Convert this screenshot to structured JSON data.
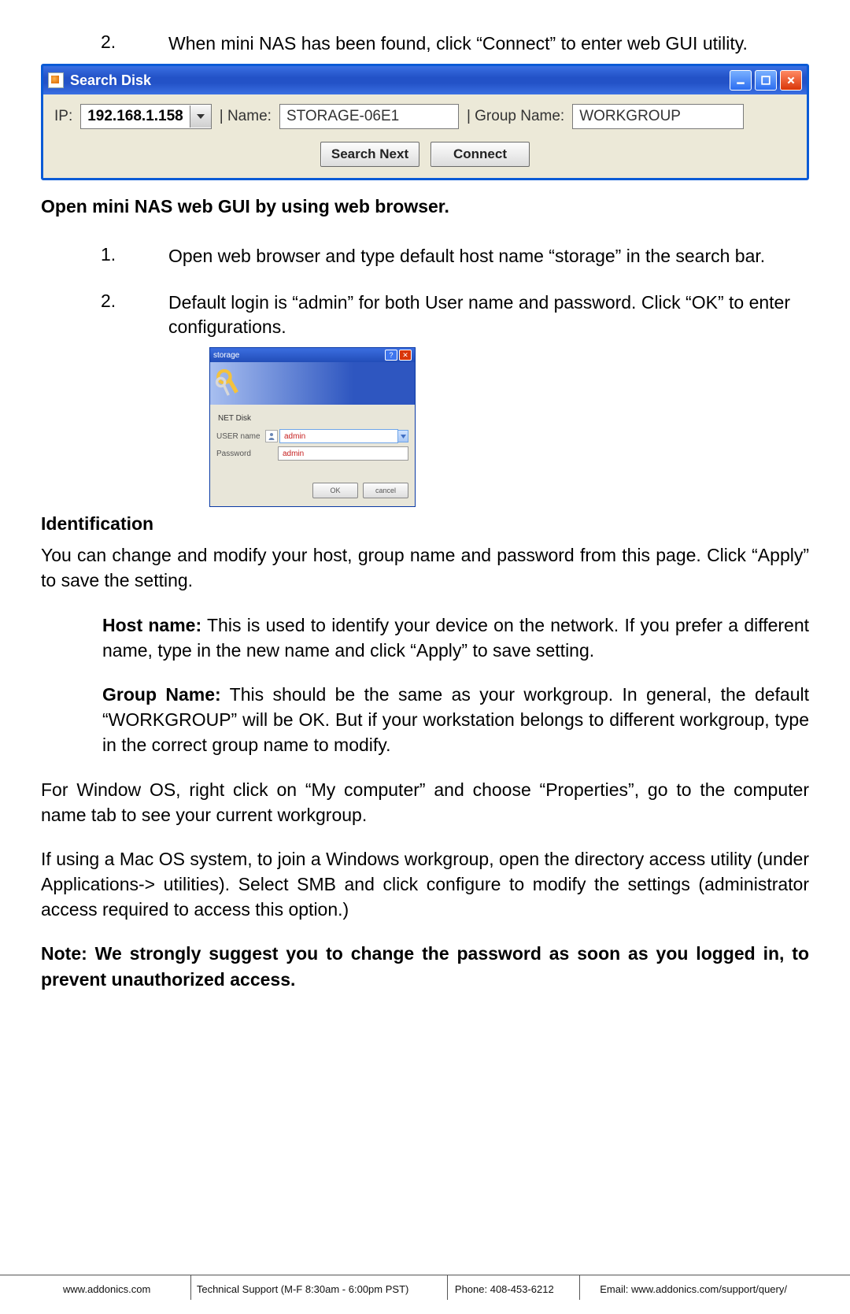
{
  "step2": {
    "num": "2.",
    "text": "When mini NAS has been found, click “Connect” to enter web GUI utility."
  },
  "searchwin": {
    "title": "Search Disk",
    "ip_label": "IP:",
    "ip_value": "192.168.1.158",
    "name_label": "| Name:",
    "name_value": "STORAGE-06E1",
    "group_label": "| Group Name:",
    "group_value": "WORKGROUP",
    "search_btn": "Search Next",
    "connect_btn": "Connect"
  },
  "heading_open": "Open mini NAS web GUI by using web browser.",
  "open1": {
    "num": "1.",
    "text": "Open web browser and type default host name “storage” in the search bar."
  },
  "open2": {
    "num": "2.",
    "text": "Default login is “admin” for both User name and password. Click “OK” to enter configurations."
  },
  "login": {
    "title": "storage",
    "site": "NET Disk",
    "user_label": "USER name",
    "user_value": "admin",
    "pass_label": "Password",
    "pass_value": "admin",
    "ok": "OK",
    "cancel": "cancel"
  },
  "ident_heading": "Identification",
  "ident_text": "You can change and modify your host, group name and password from this page. Click “Apply” to save the setting.",
  "hostname_label": "Host name:",
  "hostname_text": " This is used to identify your device on the network. If you prefer a different name, type in the new name and click “Apply” to save setting.",
  "groupname_label": "Group Name:",
  "groupname_text": " This should be the same as your workgroup. In general, the default “WORKGROUP” will be OK. But if your workstation belongs to different workgroup, type in the correct group name to modify.",
  "para_win": "For Window OS, right click on “My computer” and choose “Properties”, go to the computer name tab to see your current workgroup.",
  "para_mac": "If using a Mac OS system, to join a Windows workgroup, open the directory access utility (under Applications-> utilities). Select SMB and click configure to modify the settings (administrator access required to access this option.)",
  "note": "Note: We strongly suggest you to change the password as soon as you logged in, to prevent unauthorized access.",
  "footer": {
    "url": "www.addonics.com",
    "support": "Technical Support (M-F 8:30am - 6:00pm PST)",
    "phone": "Phone: 408-453-6212",
    "email": "Email: www.addonics.com/support/query/"
  }
}
